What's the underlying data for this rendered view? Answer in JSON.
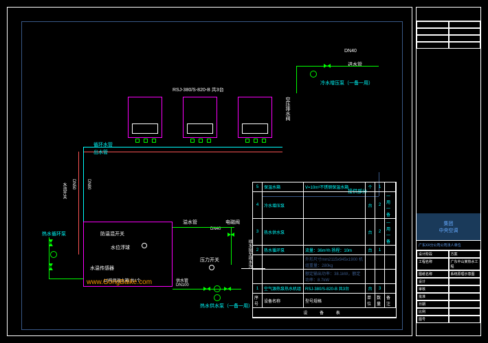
{
  "frame": {
    "units_label": "RSJ-380/S-820-B  共3台",
    "vertical_label_right": "空压排水阀"
  },
  "pipes": {
    "inlet_dn": "DN40",
    "inlet_label": "进水管",
    "cold_pump": "冷水增压泵（一备一用）",
    "circ_dn_label": "循环水管",
    "out_label": "出水管",
    "dn80_v": "DN80",
    "dn50_v": "DN50",
    "open_close": "水流开关",
    "hw_circ_pump": "热水循环泵",
    "overflow": "溢水管",
    "dn40_mid": "DN40",
    "evalve": "电磁阀",
    "drain_label": "排水接至排水沟",
    "connect_part": "接供部分",
    "pressure_sw": "压力开关",
    "supply_pipe": "供水管",
    "supply_dn": "DN100",
    "hw_supply_pump": "热水供水泵（一备一用）"
  },
  "tank": {
    "valve_label": "防温混开关",
    "level_label": "水位浮球",
    "sensor_label": "水温传感器",
    "tank_label": "10吨保温水箱  共1个"
  },
  "table": {
    "header": [
      "序号",
      "设备名称",
      "型号规格",
      "单位",
      "数量",
      "备注"
    ],
    "rows": [
      {
        "n": "5",
        "name": "保温水箱",
        "spec": "V=10m³不锈钢保温水箱",
        "u": "个",
        "q": "1",
        "r": ""
      },
      {
        "n": "4",
        "name": "冷水增压泵",
        "spec": "",
        "u": "台",
        "q": "2",
        "r": "一用一备"
      },
      {
        "n": "3",
        "name": "热水供水泵",
        "spec": "",
        "u": "台",
        "q": "2",
        "r": "一用一备"
      },
      {
        "n": "2",
        "name": "热水循环泵",
        "spec": "流量：36m³/h 扬程：10m",
        "u": "台",
        "q": "1",
        "r": ""
      },
      {
        "n": "",
        "name": "",
        "spec": "外形尺寸mm2115x945x1900 机组重量：280kg",
        "u": "",
        "q": "",
        "r": ""
      },
      {
        "n": "",
        "name": "",
        "spec": "额定输出功率：38.1kW，额定功率：8.7kW",
        "u": "",
        "q": "",
        "r": ""
      },
      {
        "n": "1",
        "name": "空气源热泵热水机组",
        "spec": "RSJ-380/S-820-B  共3台",
        "u": "台",
        "q": "3",
        "r": ""
      }
    ],
    "footer_col": "设 备 表"
  },
  "titleblock": {
    "company": "集团\n中央空调",
    "subtitle": "广东XX分公司公司法人单位",
    "sections": {
      "design_stage": "设计阶段",
      "stage_val": "方案",
      "project": "工程名称",
      "proj_val": "广东中山某热水工程",
      "drawing": "图纸名称",
      "draw_val": "系统原理示意图",
      "designer": "设计",
      "date": "日期",
      "checker": "审核",
      "scale": "比例",
      "approve": "批准",
      "no": "图号"
    }
  },
  "watermark": "www.GongBaike.com"
}
